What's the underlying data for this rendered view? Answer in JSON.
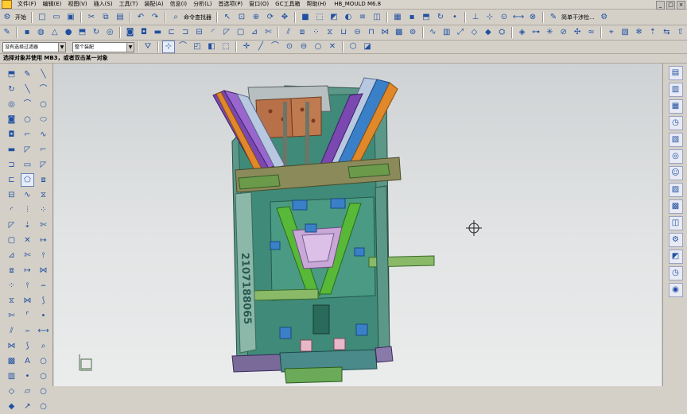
{
  "app": {
    "title": "HB_MOULD M6.8"
  },
  "menu": [
    "文件(F)",
    "编辑(E)",
    "视图(V)",
    "插入(S)",
    "工具(T)",
    "装配(A)",
    "信息(I)",
    "分析(L)",
    "首选项(P)",
    "窗口(O)",
    "GC工具箱",
    "帮助(H)"
  ],
  "toolbar1": {
    "start_label": "开始",
    "find_command_label": "命令查找器",
    "sketch_label": "简单干涉检..."
  },
  "toolbar3": {
    "filter_value": "没有选择过滤器",
    "assembly_scope_value": "整个装配"
  },
  "status": {
    "prompt": "选择对象并使用 MB3，或者双击某一对象"
  },
  "model": {
    "engraved_text": "2107188065"
  },
  "colors": {
    "plate_green": "#3f8a78",
    "blue_parts": "#3a80c8",
    "lifter_purple": "#7a48b0",
    "copper": "#b87048",
    "khaki": "#8a8a5a"
  },
  "icons": {
    "toolbar1": [
      "start-icon",
      "new-file-icon",
      "open-file-icon",
      "save-icon",
      "cut-icon",
      "copy-icon",
      "paste-icon",
      "undo-icon",
      "redo-icon",
      "find-command-icon",
      "select-icon",
      "fit-view-icon",
      "zoom-icon",
      "rotate-icon",
      "pan-icon",
      "shaded-icon",
      "wireframe-icon",
      "render-style-icon",
      "hide-icon",
      "layer-icon",
      "view-orient-icon",
      "box-icon",
      "block-icon",
      "extrude-icon",
      "revolve-icon",
      "point-icon",
      "datum-icon",
      "csys-icon",
      "snap-icon",
      "measure-icon",
      "interference-icon",
      "sketch-icon",
      "settings-icon"
    ],
    "toolbar2": [
      "sketch-icon",
      "block-icon",
      "cylinder-icon",
      "cone-icon",
      "sphere-icon",
      "extrude-icon",
      "revolve-icon",
      "hole-icon",
      "boss-icon",
      "pocket-icon",
      "pad-icon",
      "slot-icon",
      "groove-icon",
      "rib-icon",
      "blend-icon",
      "chamfer-icon",
      "shell-icon",
      "draft-icon",
      "trim-icon",
      "split-icon",
      "offset-icon",
      "pattern-icon",
      "mirror-icon",
      "unite-icon",
      "subtract-icon",
      "intersect-icon",
      "sew-icon",
      "patch-icon",
      "tube-icon",
      "sweep-icon",
      "thicken-icon",
      "scale-icon",
      "face-icon",
      "body-icon",
      "assembly-icon",
      "component-icon",
      "constraint-icon",
      "explode-icon",
      "clearance-icon",
      "move-icon",
      "wave-icon",
      "reference-icon",
      "mold-icon",
      "cooling-icon",
      "ejector-icon",
      "slider-icon",
      "lifter-icon"
    ],
    "toolbar3": [
      "filter-settings-icon",
      "select-cursor-icon",
      "curve-rule-icon",
      "face-rule-icon",
      "body-rule-icon",
      "window-select-icon",
      "snap-point-icon",
      "line-snap-icon",
      "arc-snap-icon",
      "center-snap-icon",
      "tangent-snap-icon",
      "quadrant-snap-icon",
      "intersect-snap-icon",
      "cube-view-icon",
      "view-settings-icon"
    ],
    "left_col1": [
      "extrude-icon",
      "revolve-icon",
      "hole-icon",
      "boss-icon",
      "pocket-icon",
      "pad-icon",
      "groove-icon",
      "slot-icon",
      "rib-icon",
      "blend-icon",
      "chamfer-icon",
      "shell-icon",
      "draft-icon",
      "offset-icon",
      "pattern-icon",
      "mirror-icon",
      "trim-icon",
      "split-icon",
      "sew-icon",
      "patch-icon",
      "thicken-icon",
      "face-icon",
      "body-icon"
    ],
    "left_col2": [
      "sketch-icon",
      "line-icon",
      "arc-icon",
      "circle-icon",
      "fillet-icon",
      "chamfer-icon",
      "rectangle-icon",
      "polygon-icon",
      "spline-icon",
      "offset-curve-icon",
      "project-curve-icon",
      "intersect-curve-icon",
      "trim-curve-icon",
      "extend-icon",
      "break-icon",
      "join-icon",
      "corner-icon",
      "bridge-icon",
      "helix-icon",
      "text-icon",
      "point-icon",
      "datum-plane-icon",
      "datum-axis-icon"
    ],
    "left_col3": [
      "line-icon",
      "arc-icon",
      "circle-icon",
      "ellipse-icon",
      "spline-icon",
      "fillet-icon",
      "chamfer-icon",
      "offset-icon",
      "mirror-icon",
      "pattern-icon",
      "trim-icon",
      "extend-icon",
      "break-icon",
      "join-icon",
      "bridge-icon",
      "helix-icon",
      "point-icon",
      "measure-icon",
      "analysis-icon",
      "circle-icon",
      "circle-icon",
      "circle-icon",
      "circle-icon"
    ],
    "right": [
      "assembly-nav-icon",
      "part-nav-icon",
      "constraint-nav-icon",
      "history-icon",
      "reuse-library-icon",
      "web-icon",
      "roles-icon",
      "palette-icon",
      "system-materials-icon",
      "visualization-icon",
      "process-icon",
      "rendering-icon",
      "history-icon",
      "color-palette-icon"
    ]
  }
}
